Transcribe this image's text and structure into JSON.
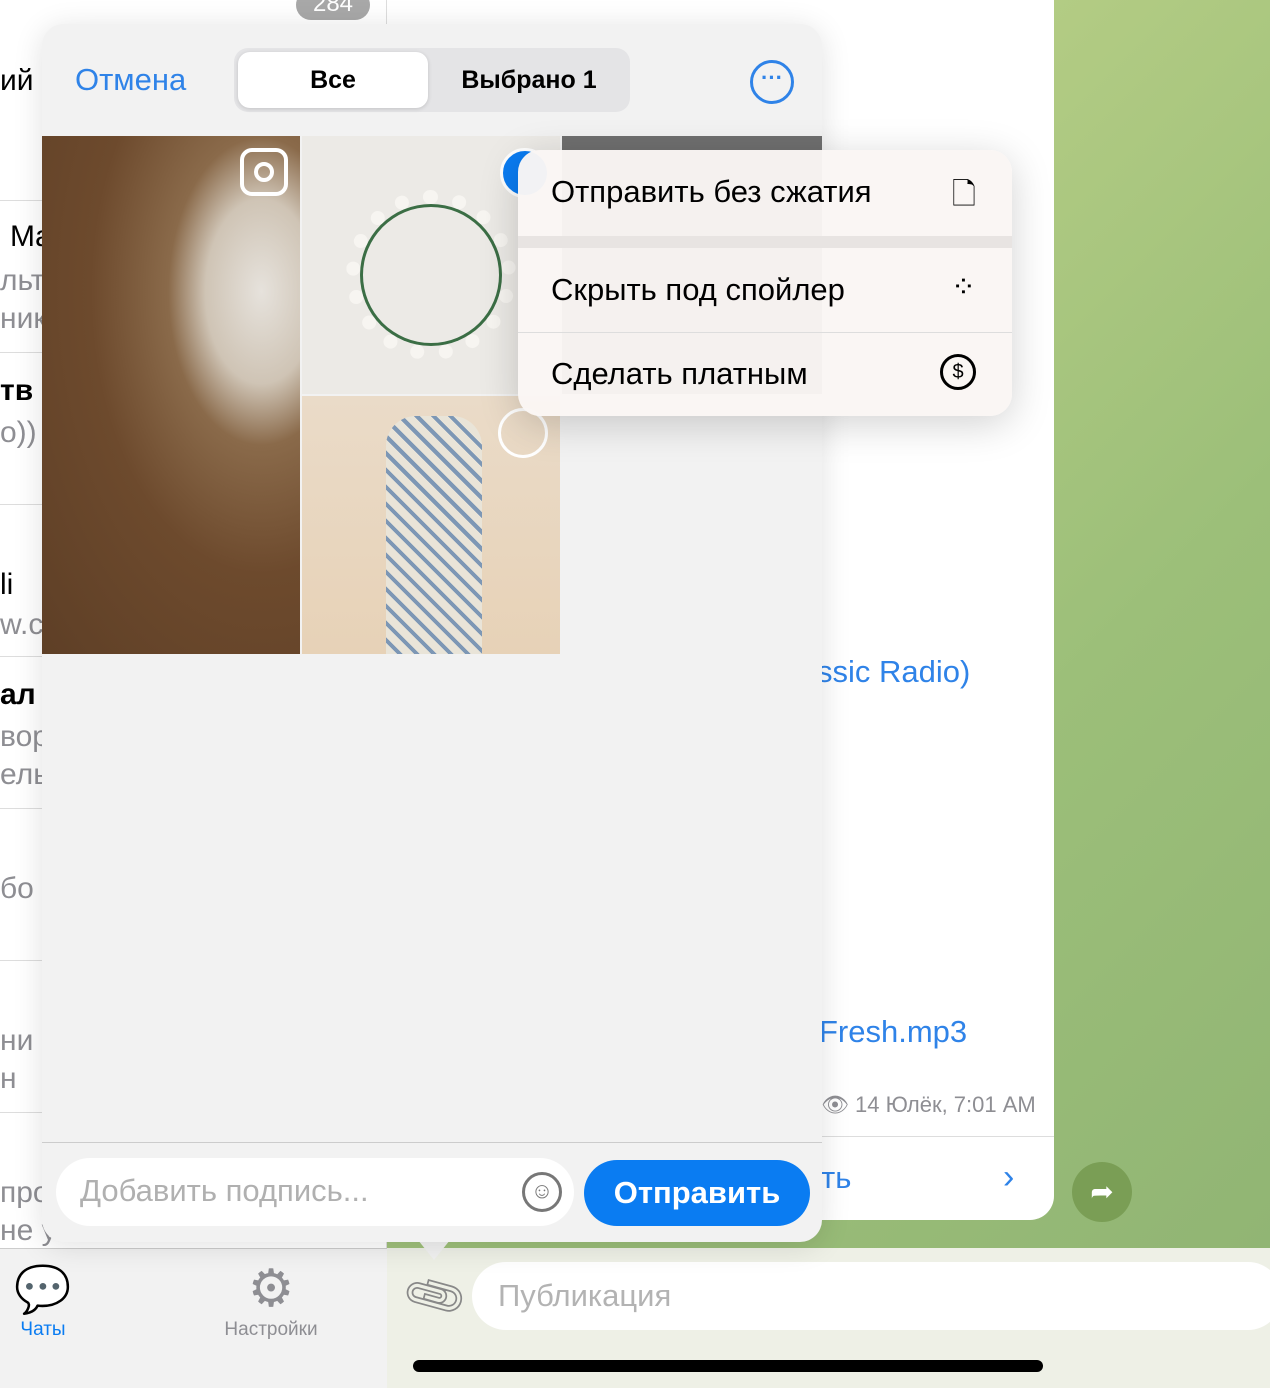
{
  "chat_list_fragments": [
    "ий",
    "Ma",
    "льт",
    "ник",
    "тв",
    "о))",
    "li",
    "w.c",
    "ал",
    "вор",
    "ель",
    "бо",
    "ни",
    "н",
    "про",
    "не у"
  ],
  "badge": "284",
  "tabbar": {
    "chats": "Чаты",
    "settings": "Настройки"
  },
  "sheet": {
    "cancel": "Отмена",
    "segments": [
      "Все",
      "Выбрано 1"
    ],
    "selected_segment": "Все",
    "caption_placeholder": "Добавить подпись...",
    "send": "Отправить"
  },
  "menu": {
    "items": [
      {
        "label": "Отправить без сжатия",
        "icon": "file-icon"
      },
      {
        "label": "Скрыть под спойлер",
        "icon": "spoiler-icon"
      },
      {
        "label": "Сделать платным",
        "icon": "dollar-circle-icon"
      }
    ]
  },
  "background_chat": {
    "s": "s",
    "radio": "ssic Radio)",
    "mp3": "Fresh.mp3",
    "meta": "14 Юлёк, 7:01 AM",
    "action": "ть"
  },
  "composer": {
    "placeholder": "Публикация"
  },
  "colors": {
    "accent": "#0a7cf2",
    "link": "#2f83e8"
  }
}
